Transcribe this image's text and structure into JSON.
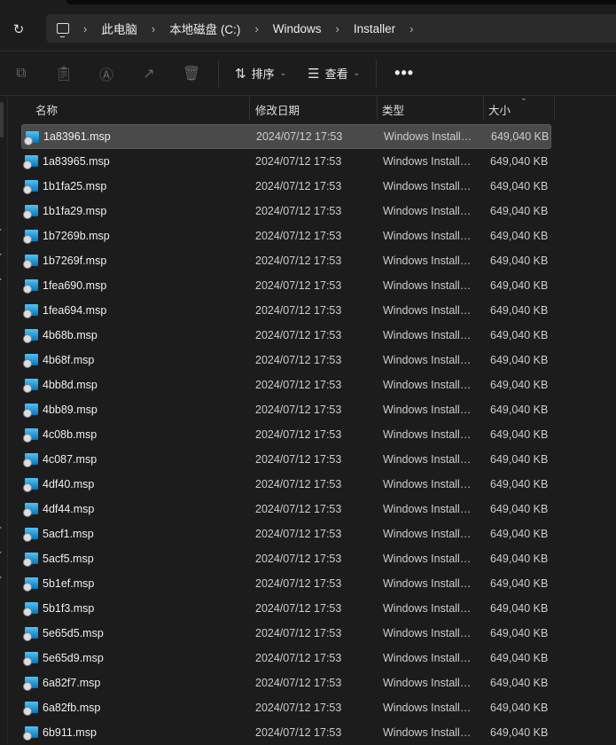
{
  "breadcrumb": [
    "此电脑",
    "本地磁盘 (C:)",
    "Windows",
    "Installer"
  ],
  "toolbar": {
    "sort_label": "排序",
    "view_label": "查看",
    "more_label": "•••"
  },
  "columns": {
    "name": "名称",
    "date": "修改日期",
    "type": "类型",
    "size": "大小"
  },
  "files": [
    {
      "name": "1a83961.msp",
      "date": "2024/07/12 17:53",
      "type": "Windows Installer Patch",
      "size": "649,040 KB"
    },
    {
      "name": "1a83965.msp",
      "date": "2024/07/12 17:53",
      "type": "Windows Installer Patch",
      "size": "649,040 KB"
    },
    {
      "name": "1b1fa25.msp",
      "date": "2024/07/12 17:53",
      "type": "Windows Installer Patch",
      "size": "649,040 KB"
    },
    {
      "name": "1b1fa29.msp",
      "date": "2024/07/12 17:53",
      "type": "Windows Installer Patch",
      "size": "649,040 KB"
    },
    {
      "name": "1b7269b.msp",
      "date": "2024/07/12 17:53",
      "type": "Windows Installer Patch",
      "size": "649,040 KB"
    },
    {
      "name": "1b7269f.msp",
      "date": "2024/07/12 17:53",
      "type": "Windows Installer Patch",
      "size": "649,040 KB"
    },
    {
      "name": "1fea690.msp",
      "date": "2024/07/12 17:53",
      "type": "Windows Installer Patch",
      "size": "649,040 KB"
    },
    {
      "name": "1fea694.msp",
      "date": "2024/07/12 17:53",
      "type": "Windows Installer Patch",
      "size": "649,040 KB"
    },
    {
      "name": "4b68b.msp",
      "date": "2024/07/12 17:53",
      "type": "Windows Installer Patch",
      "size": "649,040 KB"
    },
    {
      "name": "4b68f.msp",
      "date": "2024/07/12 17:53",
      "type": "Windows Installer Patch",
      "size": "649,040 KB"
    },
    {
      "name": "4bb8d.msp",
      "date": "2024/07/12 17:53",
      "type": "Windows Installer Patch",
      "size": "649,040 KB"
    },
    {
      "name": "4bb89.msp",
      "date": "2024/07/12 17:53",
      "type": "Windows Installer Patch",
      "size": "649,040 KB"
    },
    {
      "name": "4c08b.msp",
      "date": "2024/07/12 17:53",
      "type": "Windows Installer Patch",
      "size": "649,040 KB"
    },
    {
      "name": "4c087.msp",
      "date": "2024/07/12 17:53",
      "type": "Windows Installer Patch",
      "size": "649,040 KB"
    },
    {
      "name": "4df40.msp",
      "date": "2024/07/12 17:53",
      "type": "Windows Installer Patch",
      "size": "649,040 KB"
    },
    {
      "name": "4df44.msp",
      "date": "2024/07/12 17:53",
      "type": "Windows Installer Patch",
      "size": "649,040 KB"
    },
    {
      "name": "5acf1.msp",
      "date": "2024/07/12 17:53",
      "type": "Windows Installer Patch",
      "size": "649,040 KB"
    },
    {
      "name": "5acf5.msp",
      "date": "2024/07/12 17:53",
      "type": "Windows Installer Patch",
      "size": "649,040 KB"
    },
    {
      "name": "5b1ef.msp",
      "date": "2024/07/12 17:53",
      "type": "Windows Installer Patch",
      "size": "649,040 KB"
    },
    {
      "name": "5b1f3.msp",
      "date": "2024/07/12 17:53",
      "type": "Windows Installer Patch",
      "size": "649,040 KB"
    },
    {
      "name": "5e65d5.msp",
      "date": "2024/07/12 17:53",
      "type": "Windows Installer Patch",
      "size": "649,040 KB"
    },
    {
      "name": "5e65d9.msp",
      "date": "2024/07/12 17:53",
      "type": "Windows Installer Patch",
      "size": "649,040 KB"
    },
    {
      "name": "6a82f7.msp",
      "date": "2024/07/12 17:53",
      "type": "Windows Installer Patch",
      "size": "649,040 KB"
    },
    {
      "name": "6a82fb.msp",
      "date": "2024/07/12 17:53",
      "type": "Windows Installer Patch",
      "size": "649,040 KB"
    },
    {
      "name": "6b911.msp",
      "date": "2024/07/12 17:53",
      "type": "Windows Installer Patch",
      "size": "649,040 KB"
    }
  ]
}
